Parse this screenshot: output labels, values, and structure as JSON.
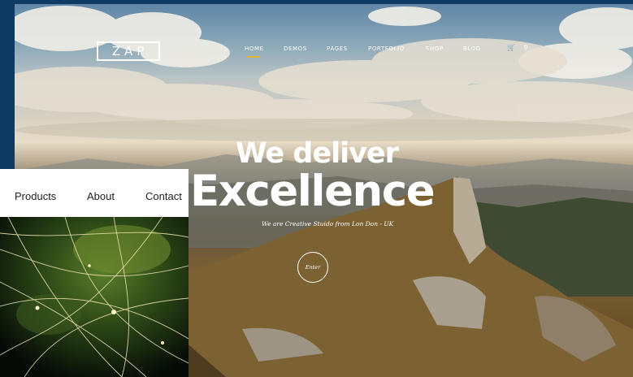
{
  "site": {
    "logo": "ZAP",
    "nav": [
      "HOME",
      "DEMOS",
      "PAGES",
      "PORTFOLIO",
      "SHOP",
      "BLOG"
    ],
    "active_nav": "HOME",
    "icons": [
      "cart-icon",
      "search-icon"
    ],
    "cart_icon": "🛒",
    "search_icon": "⚲",
    "headline_line1": "We deliver",
    "headline_line2": "Excellence",
    "tagline": "We are Creative Stuido from Lon Don - UK",
    "enter_label": "Enter",
    "accent_color": "#e2b33a"
  },
  "overlay": {
    "nav": [
      "Products",
      "About",
      "Contact"
    ]
  }
}
